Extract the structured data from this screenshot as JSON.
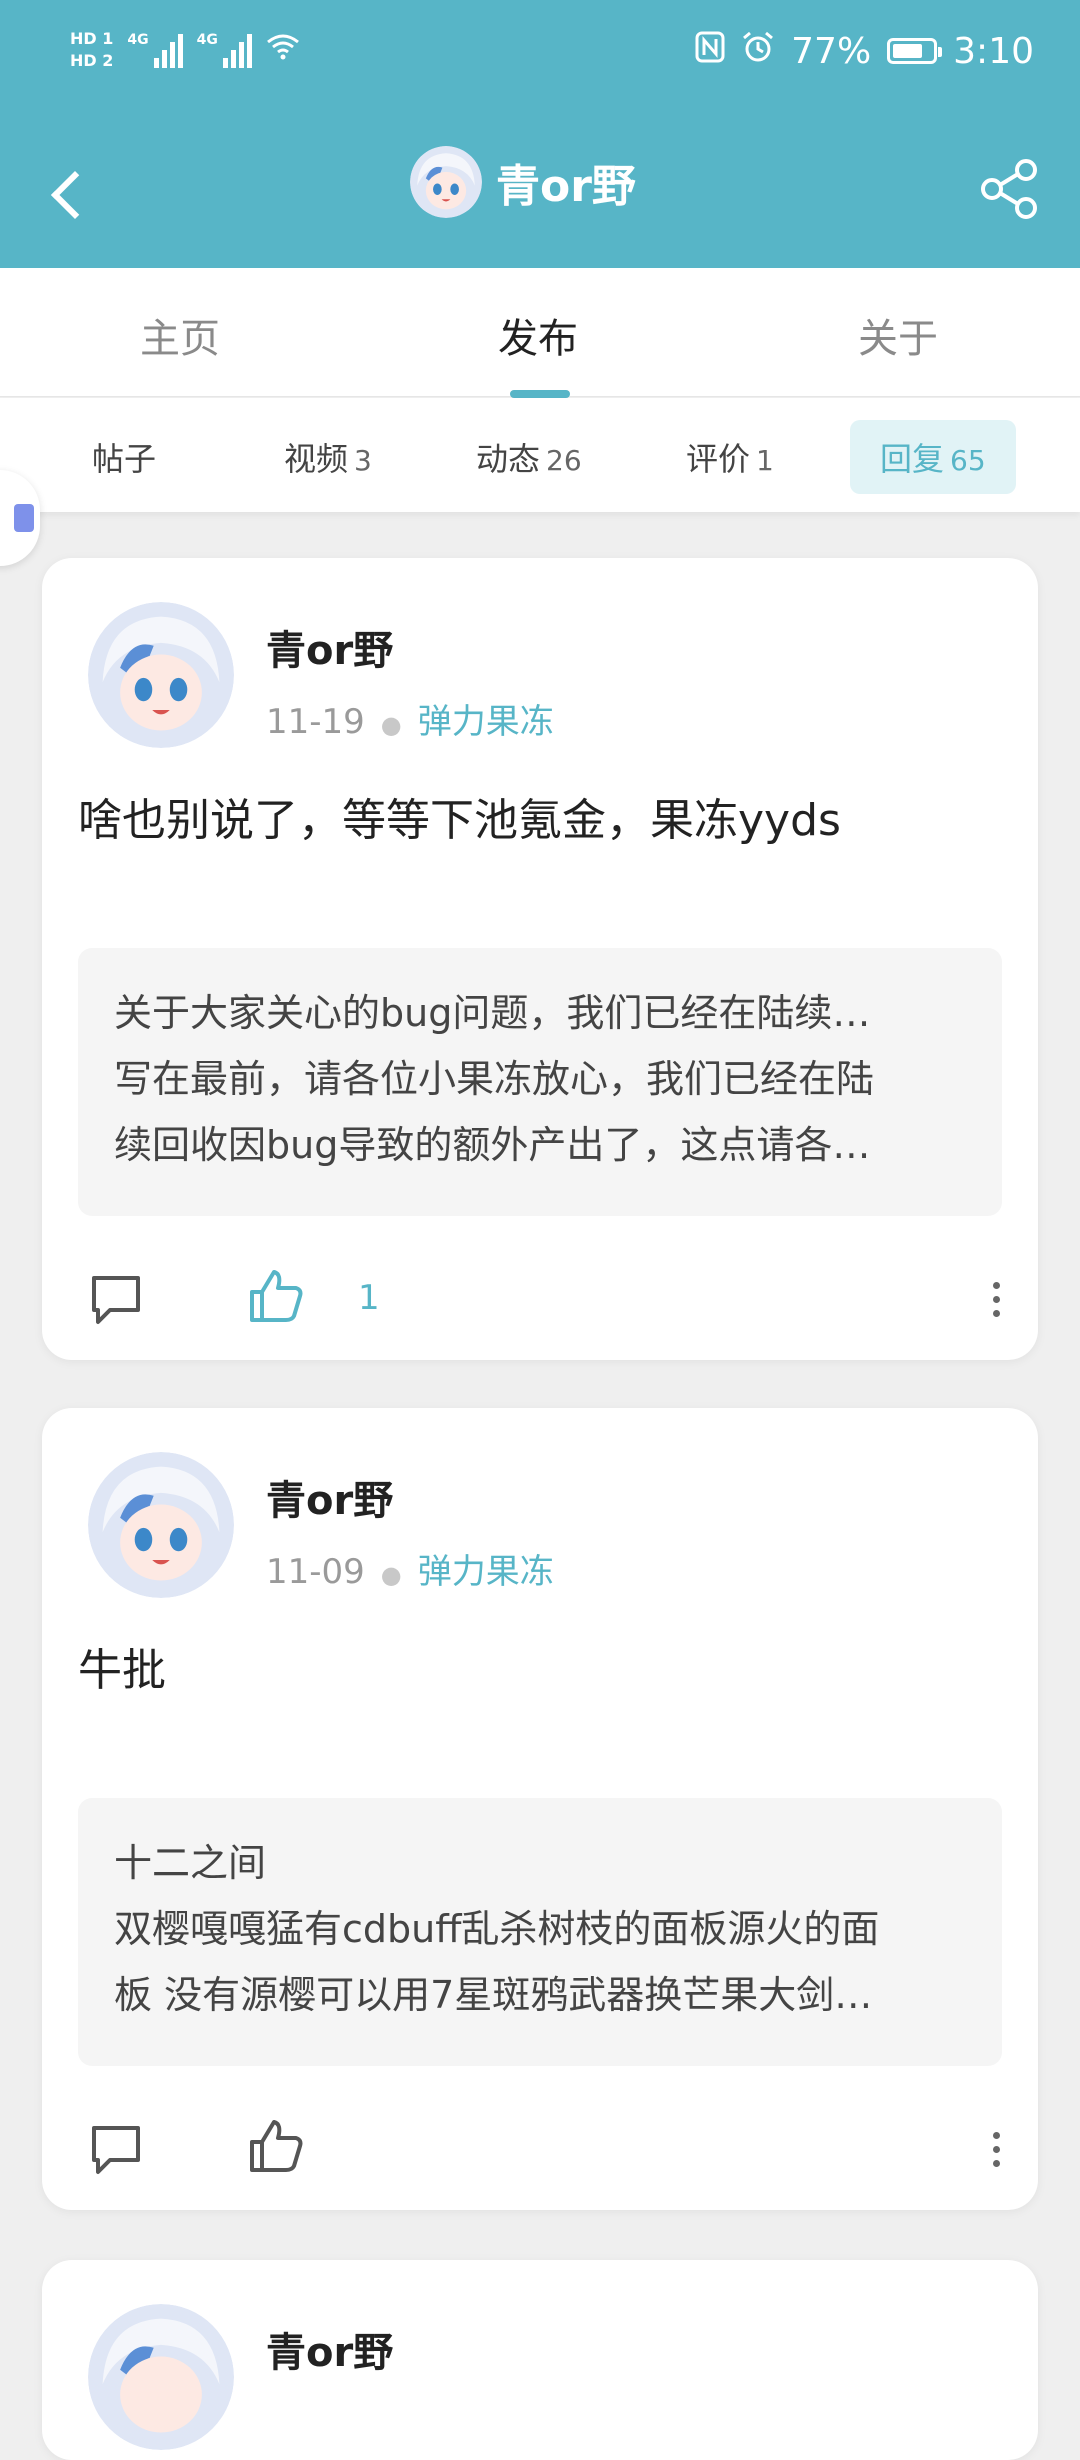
{
  "status": {
    "hd1": "HD 1",
    "hd2": "HD 2",
    "net1": "4G",
    "net2": "4G",
    "battery_pct": "77%",
    "battery_level": 0.77,
    "time": "3:10"
  },
  "header": {
    "title": "青or野"
  },
  "tabs": [
    {
      "label": "主页"
    },
    {
      "label": "发布"
    },
    {
      "label": "关于"
    }
  ],
  "subtabs": [
    {
      "label": "帖子",
      "count": ""
    },
    {
      "label": "视频",
      "count": "3"
    },
    {
      "label": "动态",
      "count": "26"
    },
    {
      "label": "评价",
      "count": "1"
    },
    {
      "label": "回复",
      "count": "65"
    }
  ],
  "posts": [
    {
      "user": "青or野",
      "date": "11-19",
      "game": "弹力果冻",
      "content": "啥也别说了，等等下池氪金，果冻yyds",
      "quote": [
        "关于大家关心的bug问题，我们已经在陆续…",
        "写在最前，请各位小果冻放心，我们已经在陆",
        "续回收因bug导致的额外产出了，这点请各…"
      ],
      "likes": "1"
    },
    {
      "user": "青or野",
      "date": "11-09",
      "game": "弹力果冻",
      "content": "牛批",
      "quote": [
        "十二之间",
        "双樱嘎嘎猛有cdbuff乱杀树枝的面板源火的面",
        "板 没有源樱可以用7星斑鸦武器换芒果大剑…"
      ],
      "likes": ""
    },
    {
      "user": "青or野"
    }
  ],
  "colors": {
    "accent": "#57b5c7",
    "header_bg": "#57b5c7"
  }
}
